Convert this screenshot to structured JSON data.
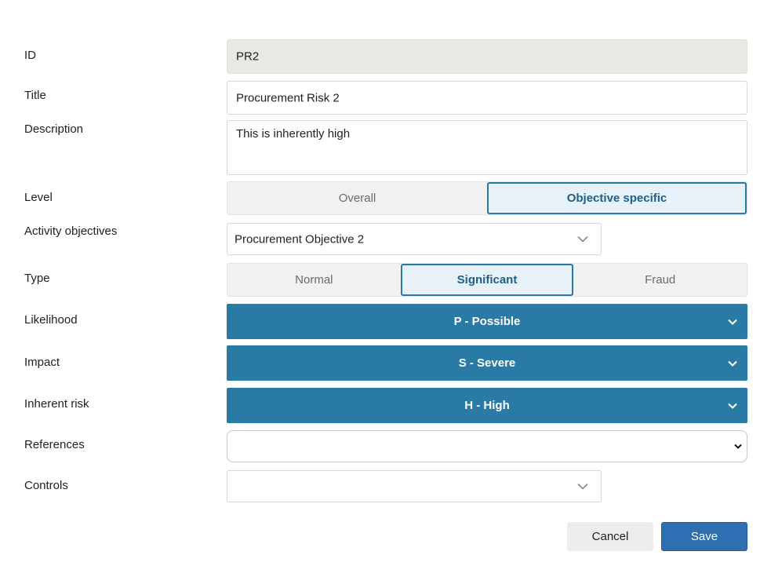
{
  "form": {
    "id": {
      "label": "ID",
      "value": "PR2"
    },
    "title": {
      "label": "Title",
      "value": "Procurement Risk 2"
    },
    "description": {
      "label": "Description",
      "value": "This is inherently high"
    },
    "level": {
      "label": "Level",
      "options": [
        "Overall",
        "Objective specific"
      ],
      "selected": "Objective specific"
    },
    "activity_objectives": {
      "label": "Activity objectives",
      "value": "Procurement Objective 2"
    },
    "type": {
      "label": "Type",
      "options": [
        "Normal",
        "Significant",
        "Fraud"
      ],
      "selected": "Significant"
    },
    "likelihood": {
      "label": "Likelihood",
      "value": "P - Possible"
    },
    "impact": {
      "label": "Impact",
      "value": "S - Severe"
    },
    "inherent_risk": {
      "label": "Inherent risk",
      "value": "H - High"
    },
    "references": {
      "label": "References",
      "value": ""
    },
    "controls": {
      "label": "Controls",
      "value": ""
    }
  },
  "actions": {
    "cancel_label": "Cancel",
    "save_label": "Save"
  },
  "colors": {
    "accent": "#2a7aa6",
    "save": "#2d6fb0",
    "active_bg": "#e6f1f9"
  },
  "icons": {
    "dropdown": "chevron-down-icon"
  }
}
